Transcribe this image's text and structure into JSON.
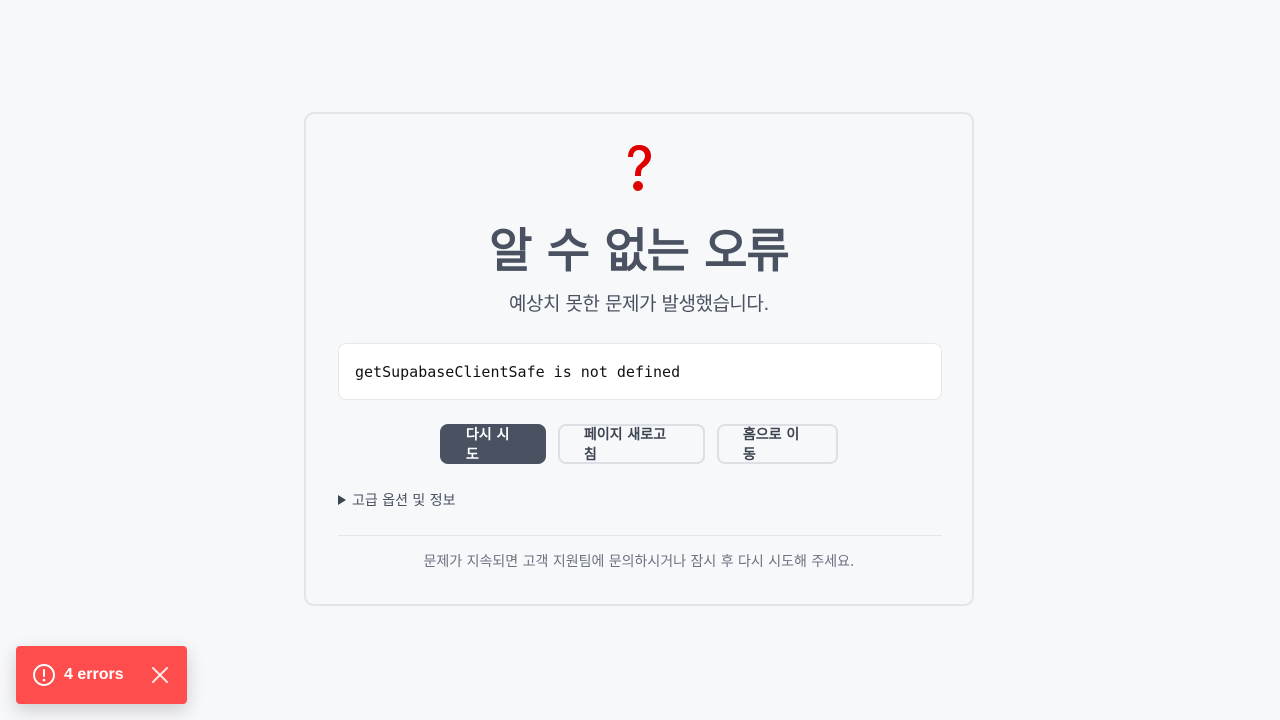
{
  "error": {
    "icon": "question-mark-icon",
    "title": "알 수 없는 오류",
    "subtitle": "예상치 못한 문제가 발생했습니다.",
    "message": "getSupabaseClientSafe is not defined"
  },
  "actions": {
    "retry_label": "다시 시도",
    "reload_label": "페이지 새로고침",
    "home_label": "홈으로 이동"
  },
  "advanced": {
    "label": "고급 옵션 및 정보"
  },
  "footer": {
    "text": "문제가 지속되면 고객 지원팀에 문의하시거나 잠시 후 다시 시도해 주세요."
  },
  "toast": {
    "label": "4 errors",
    "icon": "alert-circle-icon",
    "close_icon": "close-icon"
  },
  "colors": {
    "background": "#f7f8fa",
    "accent": "#4a5261",
    "error_icon": "#e00000",
    "toast": "#ff4d4d"
  }
}
